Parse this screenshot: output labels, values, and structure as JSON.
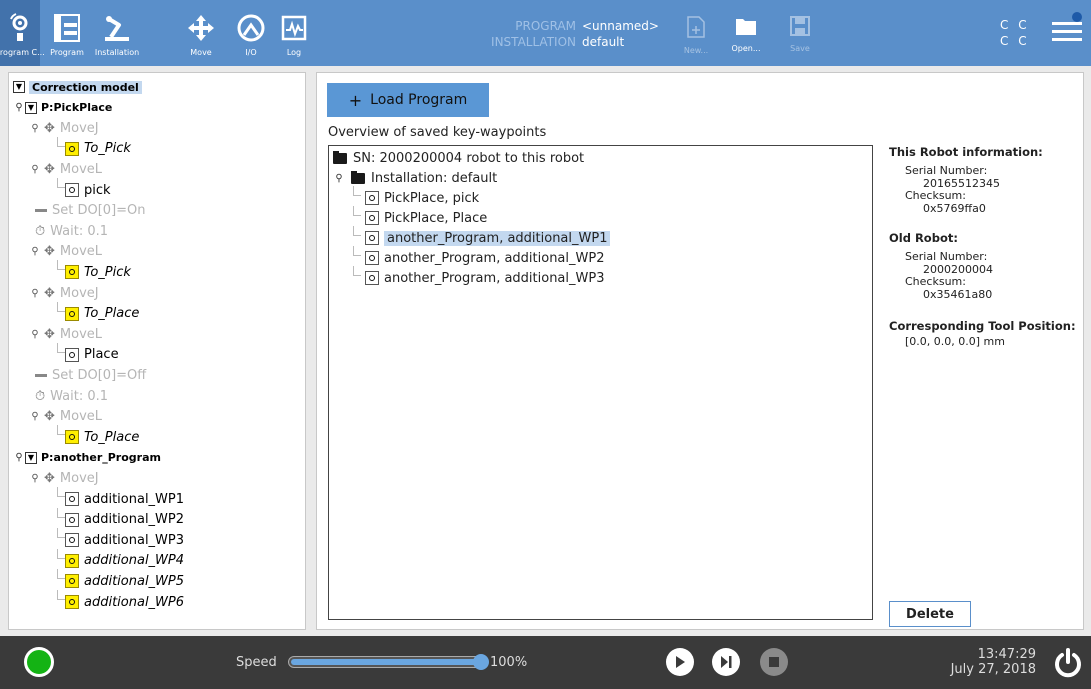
{
  "header": {
    "nav": [
      {
        "label": "Program C...",
        "icon": "robot-arm-program-icon",
        "active": true
      },
      {
        "label": "Program",
        "icon": "program-tree-icon"
      },
      {
        "label": "Installation",
        "icon": "installation-icon"
      },
      {
        "label": "Move",
        "icon": "move-arrows-icon"
      },
      {
        "label": "I/O",
        "icon": "io-icon"
      },
      {
        "label": "Log",
        "icon": "log-icon"
      }
    ],
    "program_key": "PROGRAM",
    "program_value": "<unnamed>",
    "installation_key": "INSTALLATION",
    "installation_value": "default",
    "file_buttons": [
      {
        "label": "New...",
        "icon": "new-file-icon",
        "enabled": false
      },
      {
        "label": "Open...",
        "icon": "open-folder-icon",
        "enabled": true
      },
      {
        "label": "Save",
        "icon": "save-icon",
        "enabled": false
      }
    ],
    "cc_top": "C C",
    "cc_bottom": "C C"
  },
  "tree": {
    "rows": [
      {
        "text": "Correction model",
        "kind": "root"
      },
      {
        "text": "P:PickPlace",
        "kind": "program"
      },
      {
        "text": "MoveJ",
        "kind": "move"
      },
      {
        "text": "To_Pick",
        "kind": "wp-yellow"
      },
      {
        "text": "MoveL",
        "kind": "move"
      },
      {
        "text": "pick",
        "kind": "wp"
      },
      {
        "text": "Set DO[0]=On",
        "kind": "set"
      },
      {
        "text": "Wait: 0.1",
        "kind": "wait"
      },
      {
        "text": "MoveL",
        "kind": "move"
      },
      {
        "text": "To_Pick",
        "kind": "wp-yellow"
      },
      {
        "text": "MoveJ",
        "kind": "move"
      },
      {
        "text": "To_Place",
        "kind": "wp-yellow"
      },
      {
        "text": "MoveL",
        "kind": "move"
      },
      {
        "text": "Place",
        "kind": "wp"
      },
      {
        "text": "Set DO[0]=Off",
        "kind": "set"
      },
      {
        "text": "Wait: 0.1",
        "kind": "wait"
      },
      {
        "text": "MoveL",
        "kind": "move"
      },
      {
        "text": "To_Place",
        "kind": "wp-yellow"
      },
      {
        "text": "P:another_Program",
        "kind": "program"
      },
      {
        "text": "MoveJ",
        "kind": "move"
      },
      {
        "text": "additional_WP1",
        "kind": "wp"
      },
      {
        "text": "additional_WP2",
        "kind": "wp"
      },
      {
        "text": "additional_WP3",
        "kind": "wp"
      },
      {
        "text": "additional_WP4",
        "kind": "wp-yellow"
      },
      {
        "text": "additional_WP5",
        "kind": "wp-yellow"
      },
      {
        "text": "additional_WP6",
        "kind": "wp-yellow"
      }
    ]
  },
  "main": {
    "load_button": "Load Program",
    "overview_title": "Overview of saved key-waypoints",
    "sn_row": "SN: 2000200004 robot to this robot",
    "installation_row": "Installation: default",
    "waypoints": [
      "PickPlace, pick",
      "PickPlace, Place",
      "another_Program, additional_WP1",
      "another_Program, additional_WP2",
      "another_Program, additional_WP3"
    ],
    "selected_index": 2
  },
  "info": {
    "this_robot_title": "This Robot information:",
    "serial_label": "Serial Number:",
    "this_serial": "20165512345",
    "checksum_label": "Checksum:",
    "this_checksum": "0x5769ffa0",
    "old_robot_title": "Old Robot:",
    "old_serial": "2000200004",
    "old_checksum": "0x35461a80",
    "tool_title": "Corresponding Tool Position:",
    "tool_value": "[0.0, 0.0, 0.0] mm",
    "delete_button": "Delete"
  },
  "footer": {
    "speed_label": "Speed",
    "speed_value": "100%",
    "speed_fraction": 1.0,
    "time": "13:47:29",
    "date": "July 27, 2018",
    "status_color": "#14b314"
  }
}
